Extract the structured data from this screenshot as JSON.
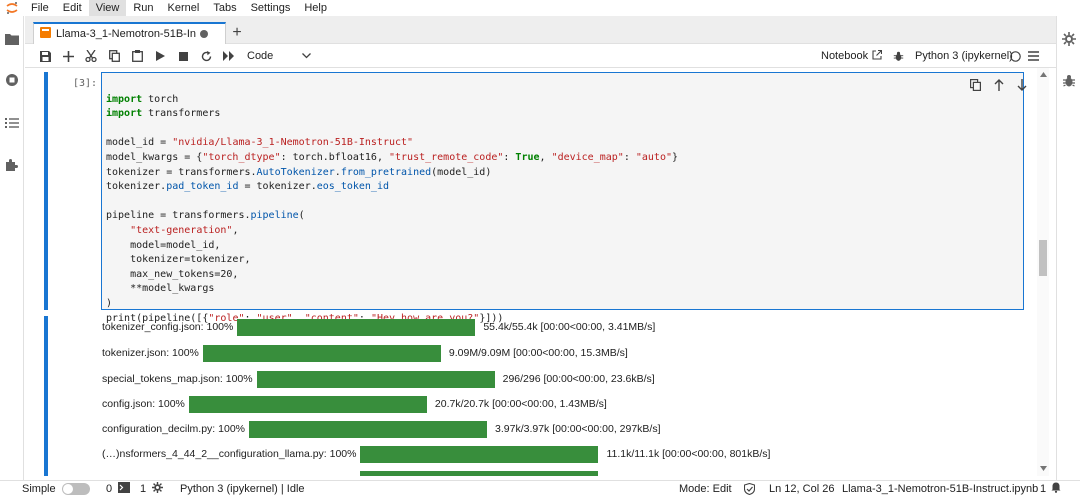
{
  "menu": {
    "items": [
      "File",
      "Edit",
      "View",
      "Run",
      "Kernel",
      "Tabs",
      "Settings",
      "Help"
    ],
    "active": "View"
  },
  "tab": {
    "title": "Llama-3_1-Nemotron-51B-In",
    "add_label": "+"
  },
  "toolbar": {
    "cell_type": "Code",
    "notebook_label": "Notebook",
    "kernel_name": "Python 3 (ipykernel)"
  },
  "cell": {
    "prompt": "[3]:",
    "code_lines": [
      "import torch",
      "import transformers",
      "",
      "model_id = \"nvidia/Llama-3_1-Nemotron-51B-Instruct\"",
      "model_kwargs = {\"torch_dtype\": torch.bfloat16, \"trust_remote_code\": True, \"device_map\": \"auto\"}",
      "tokenizer = transformers.AutoTokenizer.from_pretrained(model_id)",
      "tokenizer.pad_token_id = tokenizer.eos_token_id",
      "",
      "pipeline = transformers.pipeline(",
      "    \"text-generation\",",
      "    model=model_id,",
      "    tokenizer=tokenizer,",
      "    max_new_tokens=20,",
      "    **model_kwargs",
      ")",
      "print(pipeline([{\"role\": \"user\", \"content\": \"Hey how are you?\"}]))"
    ]
  },
  "outputs": [
    {
      "label": "tokenizer_config.json: 100%",
      "stats": "55.4k/55.4k  [00:00<00:00,  3.41MB/s]",
      "progress": 1.0
    },
    {
      "label": "tokenizer.json: 100%",
      "stats": "9.09M/9.09M  [00:00<00:00,  15.3MB/s]",
      "progress": 1.0
    },
    {
      "label": "special_tokens_map.json: 100%",
      "stats": "296/296  [00:00<00:00,  23.6kB/s]",
      "progress": 1.0
    },
    {
      "label": "config.json: 100%",
      "stats": "20.7k/20.7k  [00:00<00:00,  1.43MB/s]",
      "progress": 1.0
    },
    {
      "label": "configuration_decilm.py: 100%",
      "stats": "3.97k/3.97k  [00:00<00:00,  297kB/s]",
      "progress": 1.0
    },
    {
      "label": "(…)nsformers_4_44_2__configuration_llama.py: 100%",
      "stats": "11.1k/11.1k  [00:00<00:00,  801kB/s]",
      "progress": 1.0
    }
  ],
  "status": {
    "mode_label": "Simple",
    "terminals_count": "0",
    "kernels_count": "1",
    "kernel_status": "Python 3 (ipykernel) | Idle",
    "edit_mode": "Mode: Edit",
    "cursor_pos": "Ln 12, Col 26",
    "file_name": "Llama-3_1-Nemotron-51B-Instruct.ipynb",
    "notifications": "1"
  },
  "colors": {
    "accent": "#1976d2",
    "progress": "#388e3c",
    "jupyter_orange": "#f37726"
  }
}
